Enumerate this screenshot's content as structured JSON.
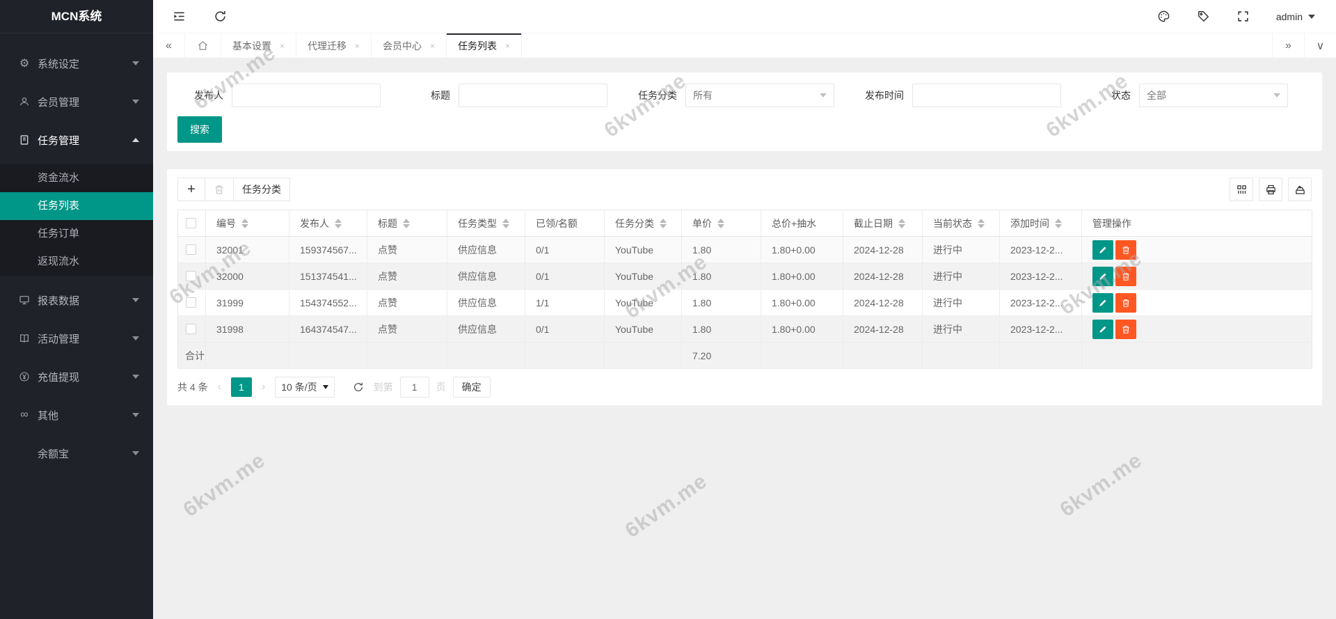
{
  "app": {
    "title": "MCN系统",
    "user": "admin"
  },
  "colors": {
    "accent": "#009688",
    "danger": "#ff5722",
    "sidebar": "#20222a"
  },
  "sidebar": {
    "items": [
      {
        "label": "系统设定",
        "icon": "gear-icon",
        "chevron": "down"
      },
      {
        "label": "会员管理",
        "icon": "user-icon",
        "chevron": "down"
      },
      {
        "label": "任务管理",
        "icon": "document-icon",
        "chevron": "up",
        "expanded": true,
        "children": [
          {
            "label": "资金流水",
            "active": false
          },
          {
            "label": "任务列表",
            "active": true
          },
          {
            "label": "任务订单",
            "active": false
          },
          {
            "label": "返现流水",
            "active": false
          }
        ]
      },
      {
        "label": "报表数据",
        "icon": "monitor-icon",
        "chevron": "down"
      },
      {
        "label": "活动管理",
        "icon": "book-icon",
        "chevron": "down"
      },
      {
        "label": "充值提现",
        "icon": "yuan-icon",
        "chevron": "down"
      },
      {
        "label": "其他",
        "icon": "infinity-icon",
        "chevron": "down"
      },
      {
        "label": "余额宝",
        "icon": "",
        "chevron": "down"
      }
    ]
  },
  "tabbar": {
    "tabs": [
      {
        "label": "基本设置",
        "active": false
      },
      {
        "label": "代理迁移",
        "active": false
      },
      {
        "label": "会员中心",
        "active": false
      },
      {
        "label": "任务列表",
        "active": true
      }
    ]
  },
  "filters": {
    "fields": [
      {
        "label": "发布人",
        "type": "input",
        "value": ""
      },
      {
        "label": "标题",
        "type": "input",
        "value": ""
      },
      {
        "label": "任务分类",
        "type": "select",
        "value": "所有"
      },
      {
        "label": "发布时间",
        "type": "input",
        "value": ""
      },
      {
        "label": "状态",
        "type": "select",
        "value": "全部"
      }
    ],
    "search_label": "搜索"
  },
  "toolbar": {
    "category_button_label": "任务分类"
  },
  "table": {
    "columns": [
      {
        "label": "编号",
        "sortable": true
      },
      {
        "label": "发布人",
        "sortable": true
      },
      {
        "label": "标题",
        "sortable": true
      },
      {
        "label": "任务类型",
        "sortable": true
      },
      {
        "label": "已领/名额",
        "sortable": false
      },
      {
        "label": "任务分类",
        "sortable": true
      },
      {
        "label": "单价",
        "sortable": true
      },
      {
        "label": "总价+抽水",
        "sortable": false
      },
      {
        "label": "截止日期",
        "sortable": true
      },
      {
        "label": "当前状态",
        "sortable": true
      },
      {
        "label": "添加时间",
        "sortable": true
      },
      {
        "label": "管理操作",
        "sortable": false
      }
    ],
    "rows": [
      {
        "id": "32001",
        "publisher": "159374567...",
        "title": "点赞",
        "task_type": "供应信息",
        "claimed_quota": "0/1",
        "category": "YouTube",
        "unit_price": "1.80",
        "total_price": "1.80+0.00",
        "deadline": "2024-12-28",
        "status": "进行中",
        "added_time": "2023-12-2..."
      },
      {
        "id": "32000",
        "publisher": "151374541...",
        "title": "点赞",
        "task_type": "供应信息",
        "claimed_quota": "0/1",
        "category": "YouTube",
        "unit_price": "1.80",
        "total_price": "1.80+0.00",
        "deadline": "2024-12-28",
        "status": "进行中",
        "added_time": "2023-12-2..."
      },
      {
        "id": "31999",
        "publisher": "154374552...",
        "title": "点赞",
        "task_type": "供应信息",
        "claimed_quota": "1/1",
        "category": "YouTube",
        "unit_price": "1.80",
        "total_price": "1.80+0.00",
        "deadline": "2024-12-28",
        "status": "进行中",
        "added_time": "2023-12-2..."
      },
      {
        "id": "31998",
        "publisher": "164374547...",
        "title": "点赞",
        "task_type": "供应信息",
        "claimed_quota": "0/1",
        "category": "YouTube",
        "unit_price": "1.80",
        "total_price": "1.80+0.00",
        "deadline": "2024-12-28",
        "status": "进行中",
        "added_time": "2023-12-2..."
      }
    ],
    "total_row": {
      "label": "合计",
      "unit_price": "7.20"
    }
  },
  "pagination": {
    "total_text": "共 4 条",
    "current_page": "1",
    "page_size_label": "10 条/页",
    "goto_prefix": "到第",
    "goto_value": "1",
    "goto_suffix": "页",
    "confirm_label": "确定"
  },
  "watermark": {
    "text": "6kvm.me"
  }
}
